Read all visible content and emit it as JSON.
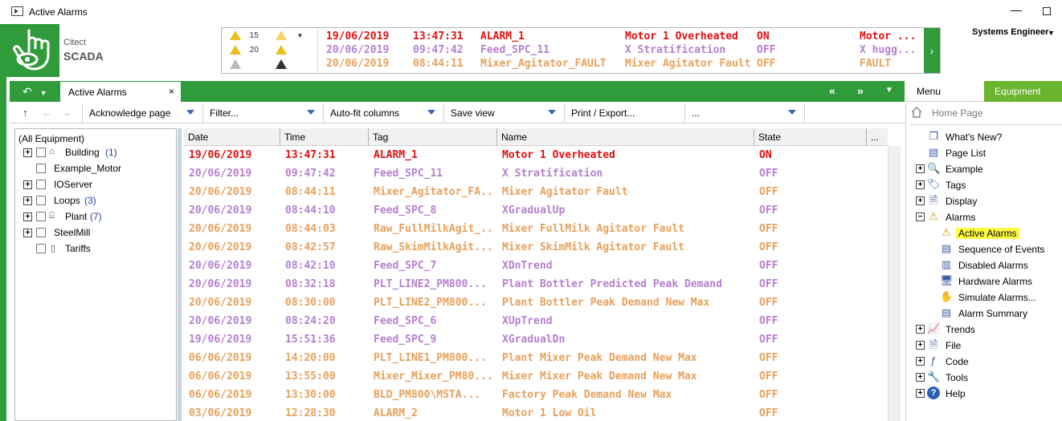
{
  "window": {
    "title": "Active Alarms"
  },
  "logo": {
    "line1": "Citect",
    "line2": "SCADA"
  },
  "banner": {
    "counts": [
      {
        "icon": "warning-ack-icon",
        "value": "15"
      },
      {
        "icon": "warning-icon",
        "value": "20"
      },
      {
        "icon": "warning-disabled-icon",
        "value": ""
      }
    ],
    "rows": [
      {
        "date": "19/06/2019",
        "time": "13:47:31",
        "tag": "ALARM_1",
        "name": "Motor 1 Overheated",
        "state": "ON",
        "extra": "Motor ...",
        "color": "#e01010"
      },
      {
        "date": "20/06/2019",
        "time": "09:47:42",
        "tag": "Feed_SPC_11",
        "name": "X Stratification",
        "state": "OFF",
        "extra": "X hugg...",
        "color": "#b57fd0"
      },
      {
        "date": "20/06/2019",
        "time": "08:44:11",
        "tag": "Mixer_Agitator_FAULT",
        "name": "Mixer Agitator Fault",
        "state": "OFF",
        "extra": "FAULT",
        "color": "#e8a05a"
      }
    ]
  },
  "user": {
    "name": "Systems Engineer"
  },
  "tabs": {
    "active_label": "Active Alarms",
    "close": "×"
  },
  "right_tabs": {
    "menu": "Menu",
    "equipment": "Equipment"
  },
  "toolbar": {
    "acknowledge": "Acknowledge page",
    "filter": "Filter...",
    "autofit": "Auto-fit columns",
    "save": "Save view",
    "print": "Print / Export...",
    "more": "..."
  },
  "tree": {
    "root": "(All Equipment)",
    "items": [
      {
        "label": "Building",
        "count": "(1)",
        "expandable": true,
        "icon": "building-icon"
      },
      {
        "label": "Example_Motor",
        "count": "",
        "expandable": false,
        "icon": ""
      },
      {
        "label": "IOServer",
        "count": "",
        "expandable": true,
        "icon": ""
      },
      {
        "label": "Loops",
        "count": "(3)",
        "expandable": true,
        "icon": ""
      },
      {
        "label": "Plant",
        "count": "(7)",
        "expandable": true,
        "icon": "plant-icon"
      },
      {
        "label": "SteelMill",
        "count": "",
        "expandable": true,
        "icon": ""
      },
      {
        "label": "Tariffs",
        "count": "",
        "expandable": false,
        "icon": "tariff-icon"
      }
    ]
  },
  "grid": {
    "columns": [
      "Date",
      "Time",
      "Tag",
      "Name",
      "State",
      "..."
    ],
    "rows": [
      {
        "date": "19/06/2019",
        "time": "13:47:31",
        "tag": "ALARM_1",
        "name": "Motor 1 Overheated",
        "state": "ON",
        "color": "#e01010"
      },
      {
        "date": "20/06/2019",
        "time": "09:47:42",
        "tag": "Feed_SPC_11",
        "name": "X Stratification",
        "state": "OFF",
        "color": "#b57fd0"
      },
      {
        "date": "20/06/2019",
        "time": "08:44:11",
        "tag": "Mixer_Agitator_FA...",
        "name": "Mixer Agitator Fault",
        "state": "OFF",
        "color": "#e8a05a"
      },
      {
        "date": "20/06/2019",
        "time": "08:44:10",
        "tag": "Feed_SPC_8",
        "name": "XGradualUp",
        "state": "OFF",
        "color": "#b57fd0"
      },
      {
        "date": "20/06/2019",
        "time": "08:44:03",
        "tag": "Raw_FullMilkAgit_...",
        "name": "Mixer FullMilk Agitator Fault",
        "state": "OFF",
        "color": "#e8a05a"
      },
      {
        "date": "20/06/2019",
        "time": "08:42:57",
        "tag": "Raw_SkimMilkAgit...",
        "name": "Mixer SkimMilk Agitator Fault",
        "state": "OFF",
        "color": "#e8a05a"
      },
      {
        "date": "20/06/2019",
        "time": "08:42:10",
        "tag": "Feed_SPC_7",
        "name": "XDnTrend",
        "state": "OFF",
        "color": "#b57fd0"
      },
      {
        "date": "20/06/2019",
        "time": "08:32:18",
        "tag": "PLT_LINE2_PM800...",
        "name": "Plant Bottler Predicted Peak Demand",
        "state": "OFF",
        "color": "#b57fd0"
      },
      {
        "date": "20/06/2019",
        "time": "08:30:00",
        "tag": "PLT_LINE2_PM800...",
        "name": "Plant Bottler Peak Demand New Max",
        "state": "OFF",
        "color": "#e8a05a"
      },
      {
        "date": "20/06/2019",
        "time": "08:24:20",
        "tag": "Feed_SPC_6",
        "name": "XUpTrend",
        "state": "OFF",
        "color": "#b57fd0"
      },
      {
        "date": "19/06/2019",
        "time": "15:51:36",
        "tag": "Feed_SPC_9",
        "name": "XGradualDn",
        "state": "OFF",
        "color": "#b57fd0"
      },
      {
        "date": "06/06/2019",
        "time": "14:20:00",
        "tag": "PLT_LINE1_PM800...",
        "name": "Plant Mixer Peak Demand New Max",
        "state": "OFF",
        "color": "#e8a05a"
      },
      {
        "date": "06/06/2019",
        "time": "13:55:00",
        "tag": "Mixer_Mixer_PM80...",
        "name": "Mixer Mixer Peak Demand New Max",
        "state": "OFF",
        "color": "#e8a05a"
      },
      {
        "date": "06/06/2019",
        "time": "13:30:00",
        "tag": "BLD_PM800\\MSTA...",
        "name": "Factory Peak Demand New Max",
        "state": "OFF",
        "color": "#e8a05a"
      },
      {
        "date": "03/06/2019",
        "time": "12:28:30",
        "tag": "ALARM_2",
        "name": "Motor 1 Low Oil",
        "state": "OFF",
        "color": "#e8a05a"
      }
    ]
  },
  "menu": {
    "home": "Home Page",
    "items": [
      {
        "label": "What's New?",
        "indent": 1,
        "expand": "",
        "icon": "whats-new-icon",
        "glyph": "❐"
      },
      {
        "label": "Page List",
        "indent": 1,
        "expand": "",
        "icon": "page-list-icon",
        "glyph": "▤"
      },
      {
        "label": "Example",
        "indent": 0,
        "expand": "+",
        "icon": "magnifier-icon",
        "glyph": "🔍"
      },
      {
        "label": "Tags",
        "indent": 0,
        "expand": "+",
        "icon": "tag-icon",
        "glyph": "🏷"
      },
      {
        "label": "Display",
        "indent": 0,
        "expand": "+",
        "icon": "display-icon",
        "glyph": "🗎"
      },
      {
        "label": "Alarms",
        "indent": 0,
        "expand": "−",
        "icon": "alarm-warning-icon",
        "glyph": "⚠"
      },
      {
        "label": "Active Alarms",
        "indent": 2,
        "expand": "",
        "icon": "active-alarms-icon",
        "glyph": "⚠",
        "highlight": true
      },
      {
        "label": "Sequence of Events",
        "indent": 2,
        "expand": "",
        "icon": "sequence-events-icon",
        "glyph": "▤"
      },
      {
        "label": "Disabled Alarms",
        "indent": 2,
        "expand": "",
        "icon": "disabled-alarms-icon",
        "glyph": "▥"
      },
      {
        "label": "Hardware Alarms",
        "indent": 2,
        "expand": "",
        "icon": "hardware-alarms-icon",
        "glyph": "🖥"
      },
      {
        "label": "Simulate Alarms...",
        "indent": 2,
        "expand": "",
        "icon": "hand-icon",
        "glyph": "✋"
      },
      {
        "label": "Alarm Summary",
        "indent": 2,
        "expand": "",
        "icon": "alarm-summary-icon",
        "glyph": "▤"
      },
      {
        "label": "Trends",
        "indent": 0,
        "expand": "+",
        "icon": "trends-icon",
        "glyph": "📈"
      },
      {
        "label": "File",
        "indent": 0,
        "expand": "+",
        "icon": "file-icon",
        "glyph": "🗎"
      },
      {
        "label": "Code",
        "indent": 0,
        "expand": "+",
        "icon": "code-icon",
        "glyph": "ƒ"
      },
      {
        "label": "Tools",
        "indent": 0,
        "expand": "+",
        "icon": "tools-icon",
        "glyph": "🔧"
      },
      {
        "label": "Help",
        "indent": 0,
        "expand": "+",
        "icon": "help-icon",
        "glyph": "?"
      }
    ]
  }
}
